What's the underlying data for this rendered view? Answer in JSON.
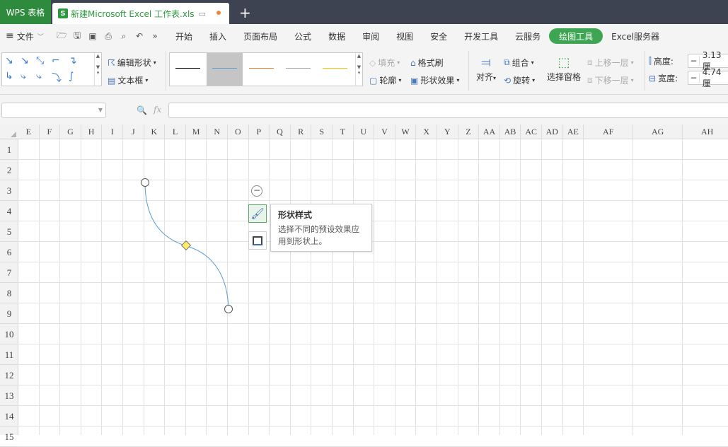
{
  "titlebar": {
    "app_tab": "WPS 表格",
    "doc_tab": "新建Microsoft Excel 工作表.xls",
    "doc_icon": "S",
    "new_tab": "+"
  },
  "menubar": {
    "file_label": "文件",
    "tabs": [
      "开始",
      "插入",
      "页面布局",
      "公式",
      "数据",
      "审阅",
      "视图",
      "安全",
      "开发工具",
      "云服务",
      "绘图工具",
      "Excel服务器"
    ],
    "active_tab": "绘图工具"
  },
  "ribbon": {
    "edit_shape": "编辑形状",
    "text_box": "文本框",
    "fill": "填充",
    "outline": "轮廓",
    "format_painter": "格式刷",
    "shape_effect": "形状效果",
    "align": "对齐",
    "group": "组合",
    "rotate": "旋转",
    "select_pane": "选择窗格",
    "bring_forward": "上移一层",
    "send_backward": "下移一层",
    "height_label": "高度:",
    "height_value": "3.13厘",
    "width_label": "宽度:",
    "width_value": "4.74厘",
    "style_colors": [
      "#000000",
      "#5b9bd5",
      "#ed7d31",
      "#a5a5a5",
      "#ffc000"
    ]
  },
  "formulabar": {
    "fx_label": "fx",
    "name_box": "",
    "formula": ""
  },
  "grid": {
    "columns": [
      "E",
      "F",
      "G",
      "H",
      "I",
      "J",
      "K",
      "L",
      "M",
      "N",
      "O",
      "P",
      "Q",
      "R",
      "S",
      "T",
      "U",
      "V",
      "W",
      "X",
      "Y",
      "Z",
      "AA",
      "AB",
      "AC",
      "AD",
      "AE",
      "AF",
      "AG",
      "AH"
    ],
    "rows": [
      "1",
      "2",
      "3",
      "4",
      "5",
      "6",
      "7",
      "8",
      "9",
      "10",
      "11",
      "12",
      "13",
      "14",
      "15"
    ]
  },
  "tooltip": {
    "title": "形状样式",
    "body_line1": "选择不同的预设效果应",
    "body_line2": "用到形状上。"
  },
  "colors": {
    "accent": "#3ea653",
    "connector": "#5b9bd5",
    "handle_yellow": "#ffee66"
  }
}
